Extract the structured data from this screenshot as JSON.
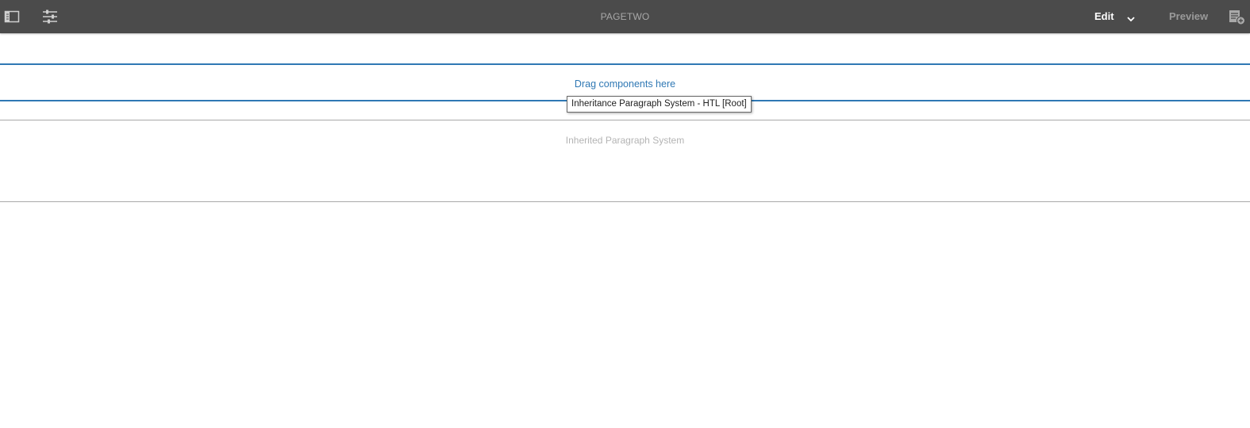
{
  "toolbar": {
    "title": "PAGETWO",
    "side_panel_icon": "side-panel-toggle-icon",
    "page_properties_icon": "sliders-icon",
    "mode_edit_label": "Edit",
    "mode_chevron_icon": "chevron-down-icon",
    "mode_preview_label": "Preview",
    "annotate_icon": "annotate-icon"
  },
  "editor": {
    "drop_zone_label": "Drag components here",
    "tooltip_label": "Inheritance Paragraph System - HTL [Root]",
    "inherited_label": "Inherited Paragraph System"
  },
  "colors": {
    "toolbar_bg": "#4b4b4b",
    "accent_blue": "#2f78b4",
    "muted_text": "#b4b4b4"
  }
}
